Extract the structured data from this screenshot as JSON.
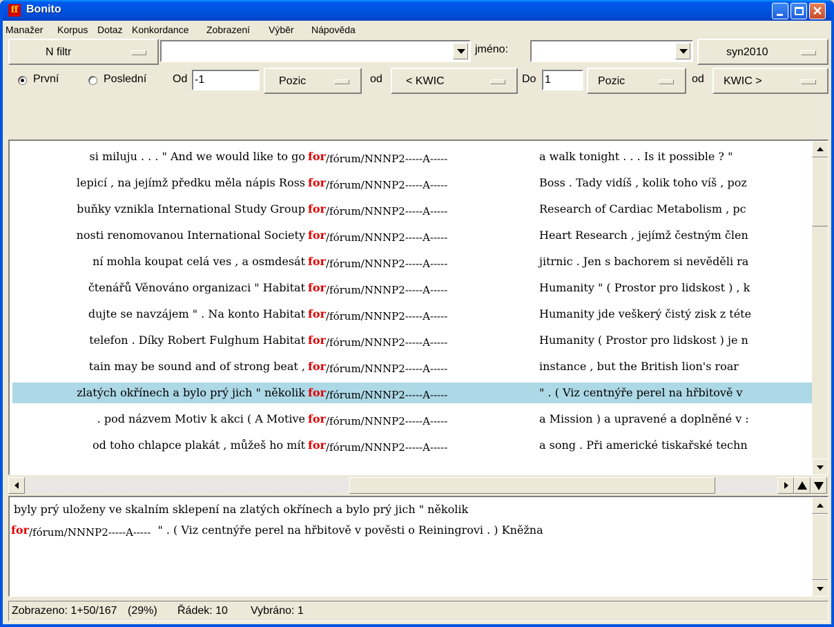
{
  "window": {
    "title": "Bonito",
    "app_icon": "ff"
  },
  "menu": [
    "Manažer",
    "Korpus",
    "Dotaz",
    "Konkordance",
    "Zobrazení",
    "Výběr",
    "Nápověda"
  ],
  "toolbar1": {
    "filter_label": "N filtr",
    "query_value": "",
    "name_label": "jméno:",
    "name_value": "",
    "corpus": "syn2010"
  },
  "toolbar2": {
    "radio_first": "První",
    "radio_last": "Poslední",
    "selected": "first",
    "from_label": "Od",
    "from_value": "-1",
    "from_unit": "Pozic",
    "from_of": "od",
    "from_ref": "< KWIC",
    "to_label": "Do",
    "to_value": "1",
    "to_unit": "Pozic",
    "to_of": "od",
    "to_ref": "KWIC >"
  },
  "concordance": {
    "keyword": "for",
    "tag": "/fórum/NNNP2-----A-----",
    "selected_row": 10,
    "rows": [
      {
        "left": "si miluju . . . \" And we would like to go",
        "right": "a walk tonight . . . Is it possible ? \""
      },
      {
        "left": "lepicí , na jejímž předku měla nápis Ross",
        "right": "Boss . Tady vidíš , kolik toho víš , poz"
      },
      {
        "left": "buňky vznikla International Study Group",
        "right": "Research of Cardiac Metabolism , pc"
      },
      {
        "left": "nosti renomovanou International Society",
        "right": "Heart Research , jejímž čestným člen"
      },
      {
        "left": "ní mohla koupat celá ves , a osmdesát",
        "right": "jitrnic . Jen s bachorem si nevěděli ra"
      },
      {
        "left": "čtenářů Věnováno organizaci \" Habitat",
        "right": "Humanity \" ( Prostor pro lidskost ) , k"
      },
      {
        "left": "dujte se navzájem \" . Na konto Habitat",
        "right": "Humanity jde veškerý čistý zisk z téte"
      },
      {
        "left": "telefon . Díky Robert Fulghum Habitat",
        "right": "Humanity ( Prostor pro lidskost ) je n"
      },
      {
        "left": "tain may be sound and of strong beat ,",
        "right": "instance , but the British lion's roar"
      },
      {
        "left": "zlatých okřínech a bylo prý jich \" několik",
        "right": "\" . ( Viz centnýře perel na hřbitově v"
      },
      {
        "left": ". pod názvem Motiv k akci ( A Motive",
        "right": "a Mission ) a upravené a doplněné v :"
      },
      {
        "left": "od toho chlapce plakát , můžeš ho mít",
        "right": "a song . Při americké tiskařské techn"
      }
    ]
  },
  "detail": {
    "line1": "byly prý uloženy ve skalním sklepení na zlatých okřínech a bylo prý jich \" několik",
    "kw": "for",
    "tag": "/fórum/NNNP2-----A-----",
    "line2_rest": "\" . ( Viz centnýře perel na hřbitově v pověsti o Reiningrovi . ) Kněžna"
  },
  "status": {
    "shown": "Zobrazeno: 1+50/167",
    "percent": "(29%)",
    "row": "Řádek: 10",
    "selected": "Vybráno: 1"
  }
}
